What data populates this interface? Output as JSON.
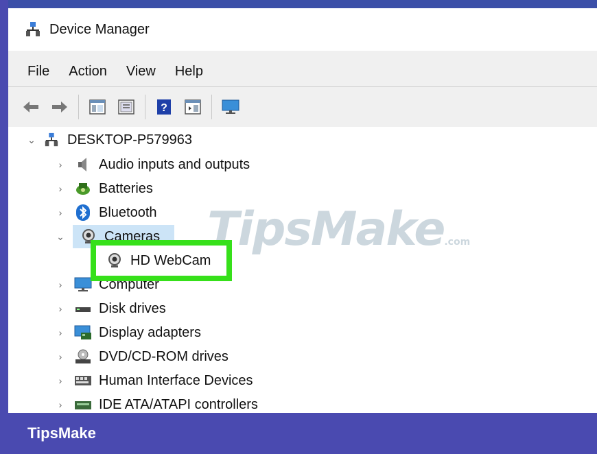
{
  "window": {
    "title": "Device Manager"
  },
  "menu": [
    "File",
    "Action",
    "View",
    "Help"
  ],
  "toolbar": {
    "buttons": [
      "back-icon",
      "forward-icon",
      "show-hide-tree-icon",
      "properties-icon",
      "help-icon",
      "details-pane-icon",
      "monitor-icon"
    ]
  },
  "tree": {
    "root": "DESKTOP-P579963",
    "categories": [
      "Audio inputs and outputs",
      "Batteries",
      "Bluetooth",
      "Cameras",
      "Computer",
      "Disk drives",
      "Display adapters",
      "DVD/CD-ROM drives",
      "Human Interface Devices",
      "IDE ATA/ATAPI controllers"
    ],
    "camera_device": "HD WebCam"
  },
  "watermark": {
    "brand": "TipsMake",
    "suffix": ".com"
  },
  "footer": {
    "brand": "TipsMake"
  },
  "colors": {
    "highlight": "#36e01a",
    "footer_bg": "#4a4ab0",
    "selection": "#cce4f7"
  }
}
